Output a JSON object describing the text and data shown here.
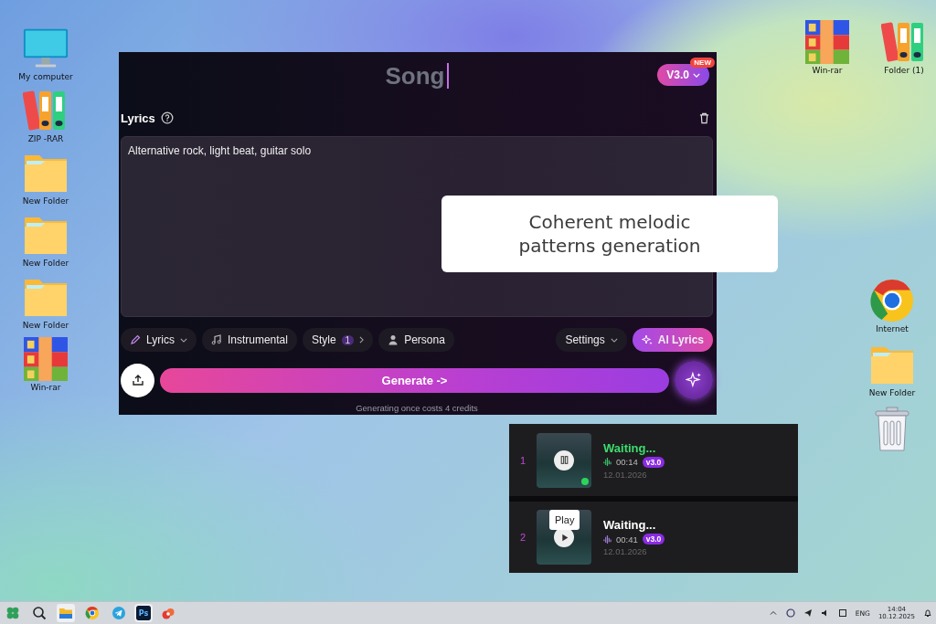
{
  "desktop": {
    "left_icons": [
      {
        "kind": "monitor",
        "label": "My computer"
      },
      {
        "kind": "binders",
        "label": "ZIP -RAR"
      },
      {
        "kind": "folder",
        "label": "New Folder"
      },
      {
        "kind": "folder",
        "label": "New Folder"
      },
      {
        "kind": "folder",
        "label": "New Folder"
      },
      {
        "kind": "archive",
        "label": "Win-rar"
      }
    ],
    "top_right_icons": [
      {
        "kind": "archive",
        "label": "Win-rar"
      },
      {
        "kind": "binders",
        "label": "Folder (1)"
      }
    ],
    "right_icons": [
      {
        "kind": "browser",
        "label": "Internet"
      },
      {
        "kind": "folder",
        "label": "New Folder"
      },
      {
        "kind": "trash"
      }
    ]
  },
  "song_editor": {
    "title": "Song",
    "version": "V3.0",
    "version_badge": "NEW",
    "lyrics_label": "Lyrics",
    "prompt_value": "Alternative rock, light beat, guitar solo",
    "chips": [
      {
        "kind": "pencil",
        "label": "Lyrics",
        "dropdown": true
      },
      {
        "kind": "note",
        "label": "Instrumental"
      },
      {
        "kind": "plain",
        "label": "Style",
        "count": "1",
        "expandable": true
      },
      {
        "kind": "person",
        "label": "Persona"
      }
    ],
    "settings": {
      "label": "Settings",
      "dropdown": true
    },
    "ai_lyrics": {
      "label": "AI Lyrics"
    },
    "generate": {
      "label": "Generate ->"
    },
    "cost_note": "Generating once costs 4 credits"
  },
  "callout": {
    "text": "Coherent melodic patterns generation"
  },
  "tracks": [
    {
      "number": "1",
      "title": "Waiting...",
      "playing": true,
      "duration": "00:14",
      "version": "v3.0",
      "date": "12.01.2026"
    },
    {
      "number": "2",
      "title": "Waiting...",
      "playing": false,
      "duration": "00:41",
      "version": "v3.0",
      "date": "12.01.2026",
      "tooltip": "Play"
    }
  ],
  "taskbar": {
    "apps": [
      {
        "kind": "start"
      },
      {
        "kind": "search"
      },
      {
        "kind": "explorer"
      },
      {
        "kind": "chrome"
      },
      {
        "kind": "telegram"
      },
      {
        "kind": "photoshop",
        "label": "Ps"
      },
      {
        "kind": "app"
      }
    ],
    "language": "ENG",
    "time": "14:04",
    "date": "10.12.2025"
  }
}
